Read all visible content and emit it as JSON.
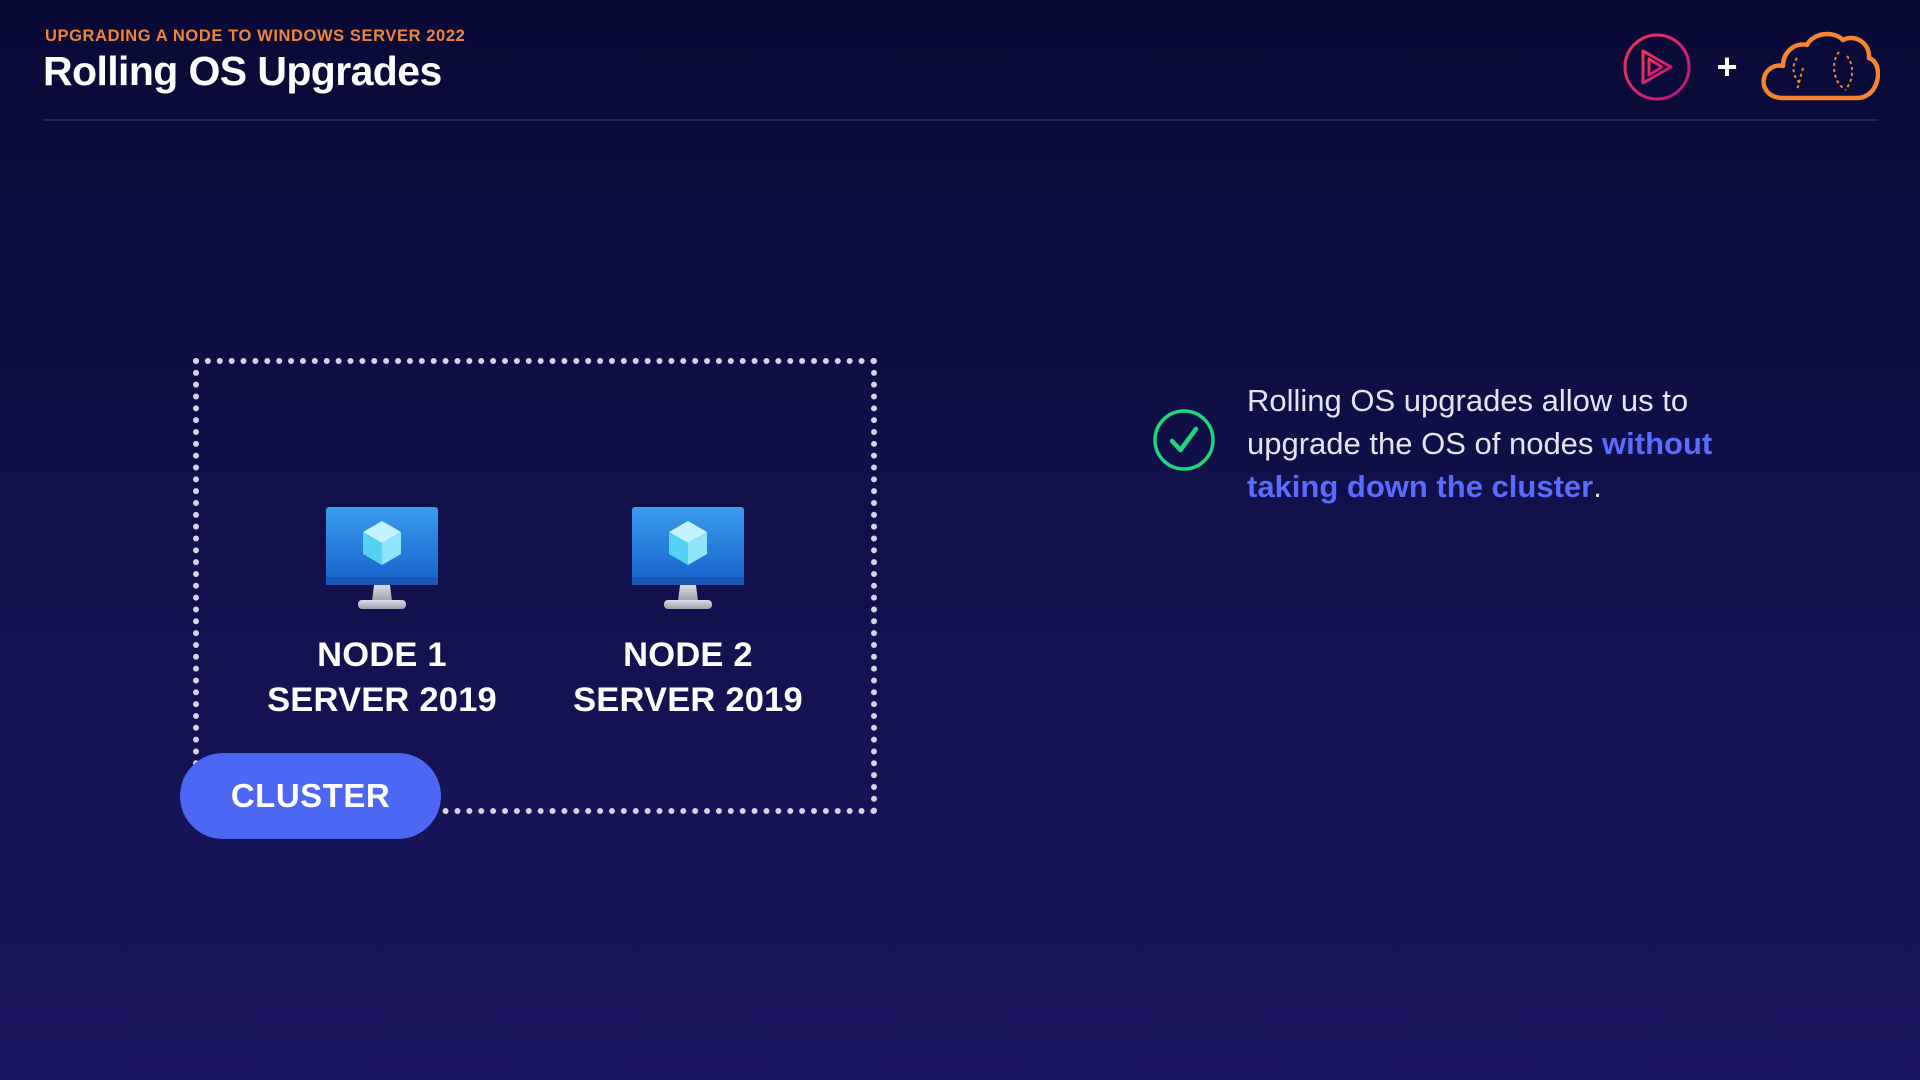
{
  "header": {
    "eyebrow": "UPGRADING A NODE TO WINDOWS SERVER 2022",
    "title": "Rolling OS Upgrades",
    "plus": "+"
  },
  "diagram": {
    "nodes": [
      {
        "line1": "NODE 1",
        "line2": "SERVER 2019",
        "icon": "monitor-icon"
      },
      {
        "line1": "NODE 2",
        "line2": "SERVER 2019",
        "icon": "monitor-icon"
      }
    ],
    "cluster_label": "CLUSTER"
  },
  "point": {
    "text_before": "Rolling OS upgrades allow us to upgrade the OS of nodes ",
    "highlight": "without taking down the cluster",
    "text_after": ".",
    "icon": "check-circle-icon"
  },
  "colors": {
    "accent_orange": "#f0843a",
    "accent_blue": "#4b67f4",
    "highlight_blue": "#5a6cff",
    "check_green": "#1fd67a",
    "brand_pink": "#e8266f",
    "bg_top": "#0a0a36",
    "bg_bottom": "#1b1660"
  }
}
